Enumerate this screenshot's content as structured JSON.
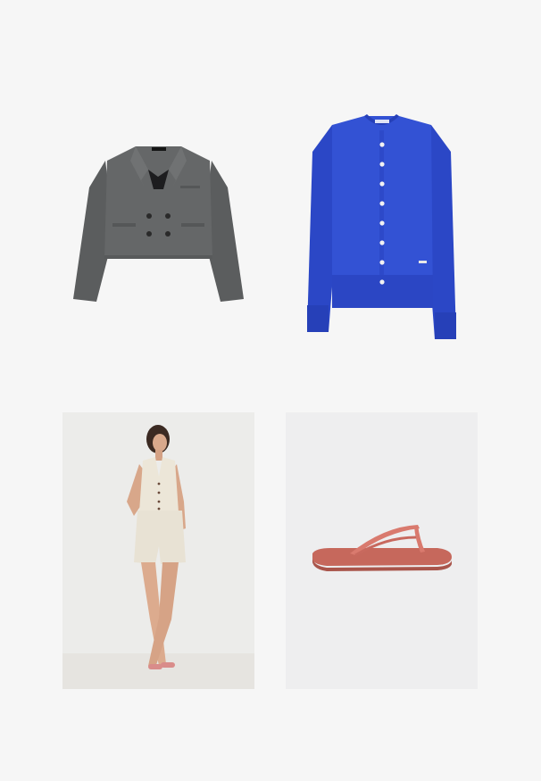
{
  "collage": {
    "items": [
      {
        "id": "jacket",
        "label_text": "",
        "color": "#606262"
      },
      {
        "id": "cardigan",
        "label_text": "",
        "color": "#2f4fce"
      },
      {
        "id": "model",
        "label_text": "",
        "color": "#ebe6dc"
      },
      {
        "id": "sandal",
        "label_text": "",
        "color": "#c76a5e"
      }
    ]
  }
}
